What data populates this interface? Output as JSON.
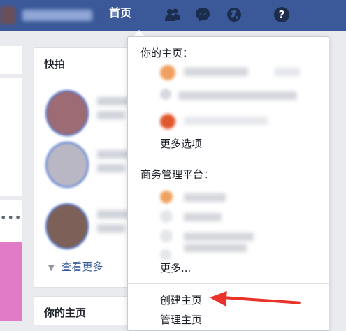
{
  "header": {
    "home_label": "首页",
    "help_label": "?"
  },
  "left_panel": {
    "title": "快拍",
    "see_more": "查看更多"
  },
  "bottom_panel": {
    "title": "你的主页"
  },
  "dropdown": {
    "your_pages_label": "你的主页：",
    "more_options": "更多选项",
    "business_label": "商务管理平台：",
    "more_truncated": "更多...",
    "create_page": "创建主页",
    "manage_pages": "管理主页"
  },
  "colors": {
    "brand": "#3b5998",
    "link": "#365899",
    "arrow": "#e8322a"
  }
}
